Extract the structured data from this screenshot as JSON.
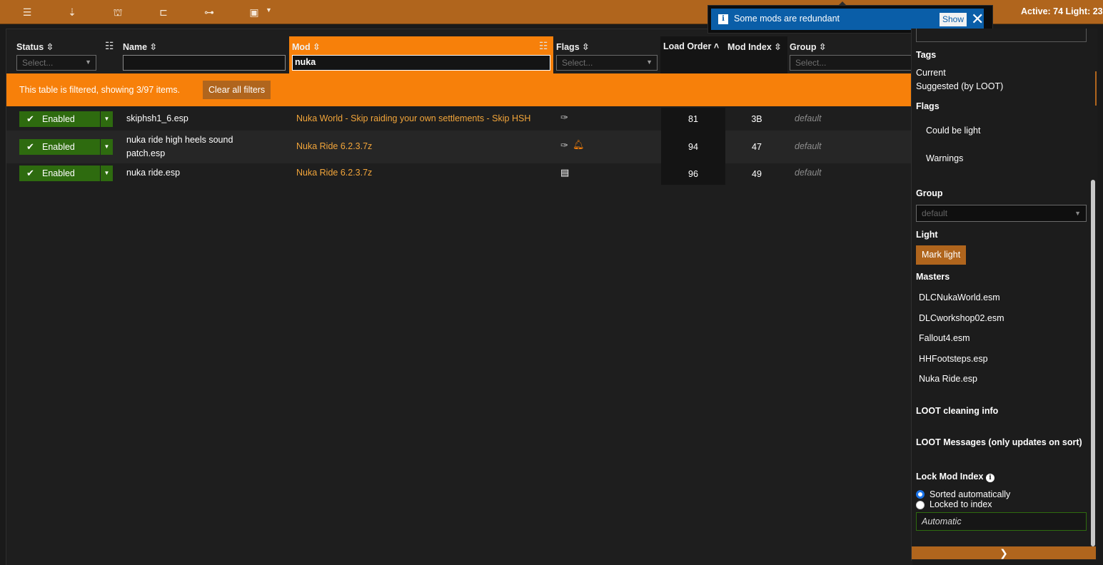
{
  "toolbar": {
    "icons": [
      "sort-list-icon",
      "sort-order-icon",
      "hierarchy-icon",
      "branch-icon",
      "tree-icon",
      "film-icon"
    ],
    "active_count": "Active: 74 Light: 23"
  },
  "notification": {
    "text": "Some mods are redundant",
    "show_label": "Show",
    "close_symbol": "✕"
  },
  "columns": {
    "status": "Status",
    "name": "Name",
    "mod": "Mod",
    "flags": "Flags",
    "load_order": "Load Order",
    "mod_index": "Mod Index",
    "group": "Group"
  },
  "filters": {
    "status_placeholder": "Select...",
    "name_value": "",
    "mod_value": "nuka",
    "flags_placeholder": "Select...",
    "group_placeholder": "Select..."
  },
  "banner": {
    "text": "This table is filtered, showing 3/97 items.",
    "clear_label": "Clear all filters"
  },
  "rows": [
    {
      "status": "Enabled",
      "name": "skiphsh1_6.esp",
      "mod": "Nuka World - Skip raiding your own settlements - Skip HSH",
      "load_order": "81",
      "mod_index": "3B",
      "group": "default"
    },
    {
      "status": "Enabled",
      "name": "nuka ride high heels sound patch.esp",
      "mod": "Nuka Ride 6.2.3.7z",
      "load_order": "94",
      "mod_index": "47",
      "group": "default"
    },
    {
      "status": "Enabled",
      "name": "nuka ride.esp",
      "mod": "Nuka Ride 6.2.3.7z",
      "load_order": "96",
      "mod_index": "49",
      "group": "default"
    }
  ],
  "side": {
    "tags_heading": "Tags",
    "current_label": "Current",
    "suggested_label": "Suggested (by LOOT)",
    "flags_heading": "Flags",
    "could_be_light": "Could be light",
    "warnings": "Warnings",
    "group_heading": "Group",
    "group_value": "default",
    "light_heading": "Light",
    "mark_light": "Mark light",
    "masters_heading": "Masters",
    "masters": [
      "DLCNukaWorld.esm",
      "DLCworkshop02.esm",
      "Fallout4.esm",
      "HHFootsteps.esp",
      "Nuka Ride.esp"
    ],
    "loot_cleaning": "LOOT cleaning info",
    "loot_messages": "LOOT Messages (only updates on sort)",
    "lock_heading": "Lock Mod Index",
    "sorted_auto": "Sorted automatically",
    "locked_index": "Locked to index",
    "auto_value": "Automatic"
  },
  "colors": {
    "accent": "#b0651d",
    "highlight": "#f7800a",
    "enabled": "#2e6b0f",
    "info": "#0a5ea8"
  }
}
